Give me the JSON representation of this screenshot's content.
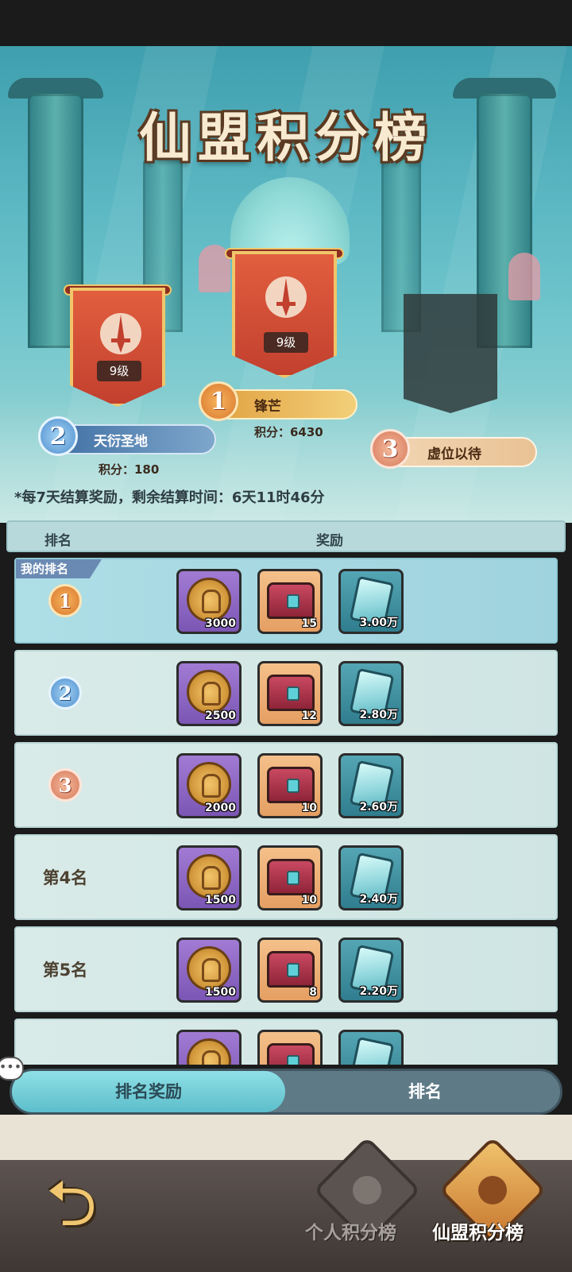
{
  "header": {
    "title": "仙盟积分榜"
  },
  "podium": [
    {
      "place": "1",
      "name": "锋芒",
      "level": "9级",
      "score_label": "积分：6430"
    },
    {
      "place": "2",
      "name": "天衍圣地",
      "level": "9级",
      "score_label": "积分：180"
    },
    {
      "place": "3",
      "name": "虚位以待"
    }
  ],
  "notice": "*每7天结算奖励，剩余结算时间：6天11时46分",
  "table": {
    "rank_header": "排名",
    "reward_header": "奖励",
    "my_rank_tag": "我的排名",
    "rows": [
      {
        "rank": "1",
        "coin": "3000",
        "chest": "15",
        "jade": "3.00万"
      },
      {
        "rank": "2",
        "coin": "2500",
        "chest": "12",
        "jade": "2.80万"
      },
      {
        "rank": "3",
        "coin": "2000",
        "chest": "10",
        "jade": "2.60万"
      },
      {
        "rank": "第4名",
        "coin": "1500",
        "chest": "10",
        "jade": "2.40万"
      },
      {
        "rank": "第5名",
        "coin": "1500",
        "chest": "8",
        "jade": "2.20万"
      }
    ]
  },
  "tabs": {
    "active": "排名奖励",
    "inactive": "排名"
  },
  "nav": {
    "personal": "个人积分榜",
    "alliance": "仙盟积分榜"
  },
  "colors": {
    "banner_red": "#d0492f",
    "gold": "#f0c66a",
    "tab_active": "#6fd0da"
  }
}
